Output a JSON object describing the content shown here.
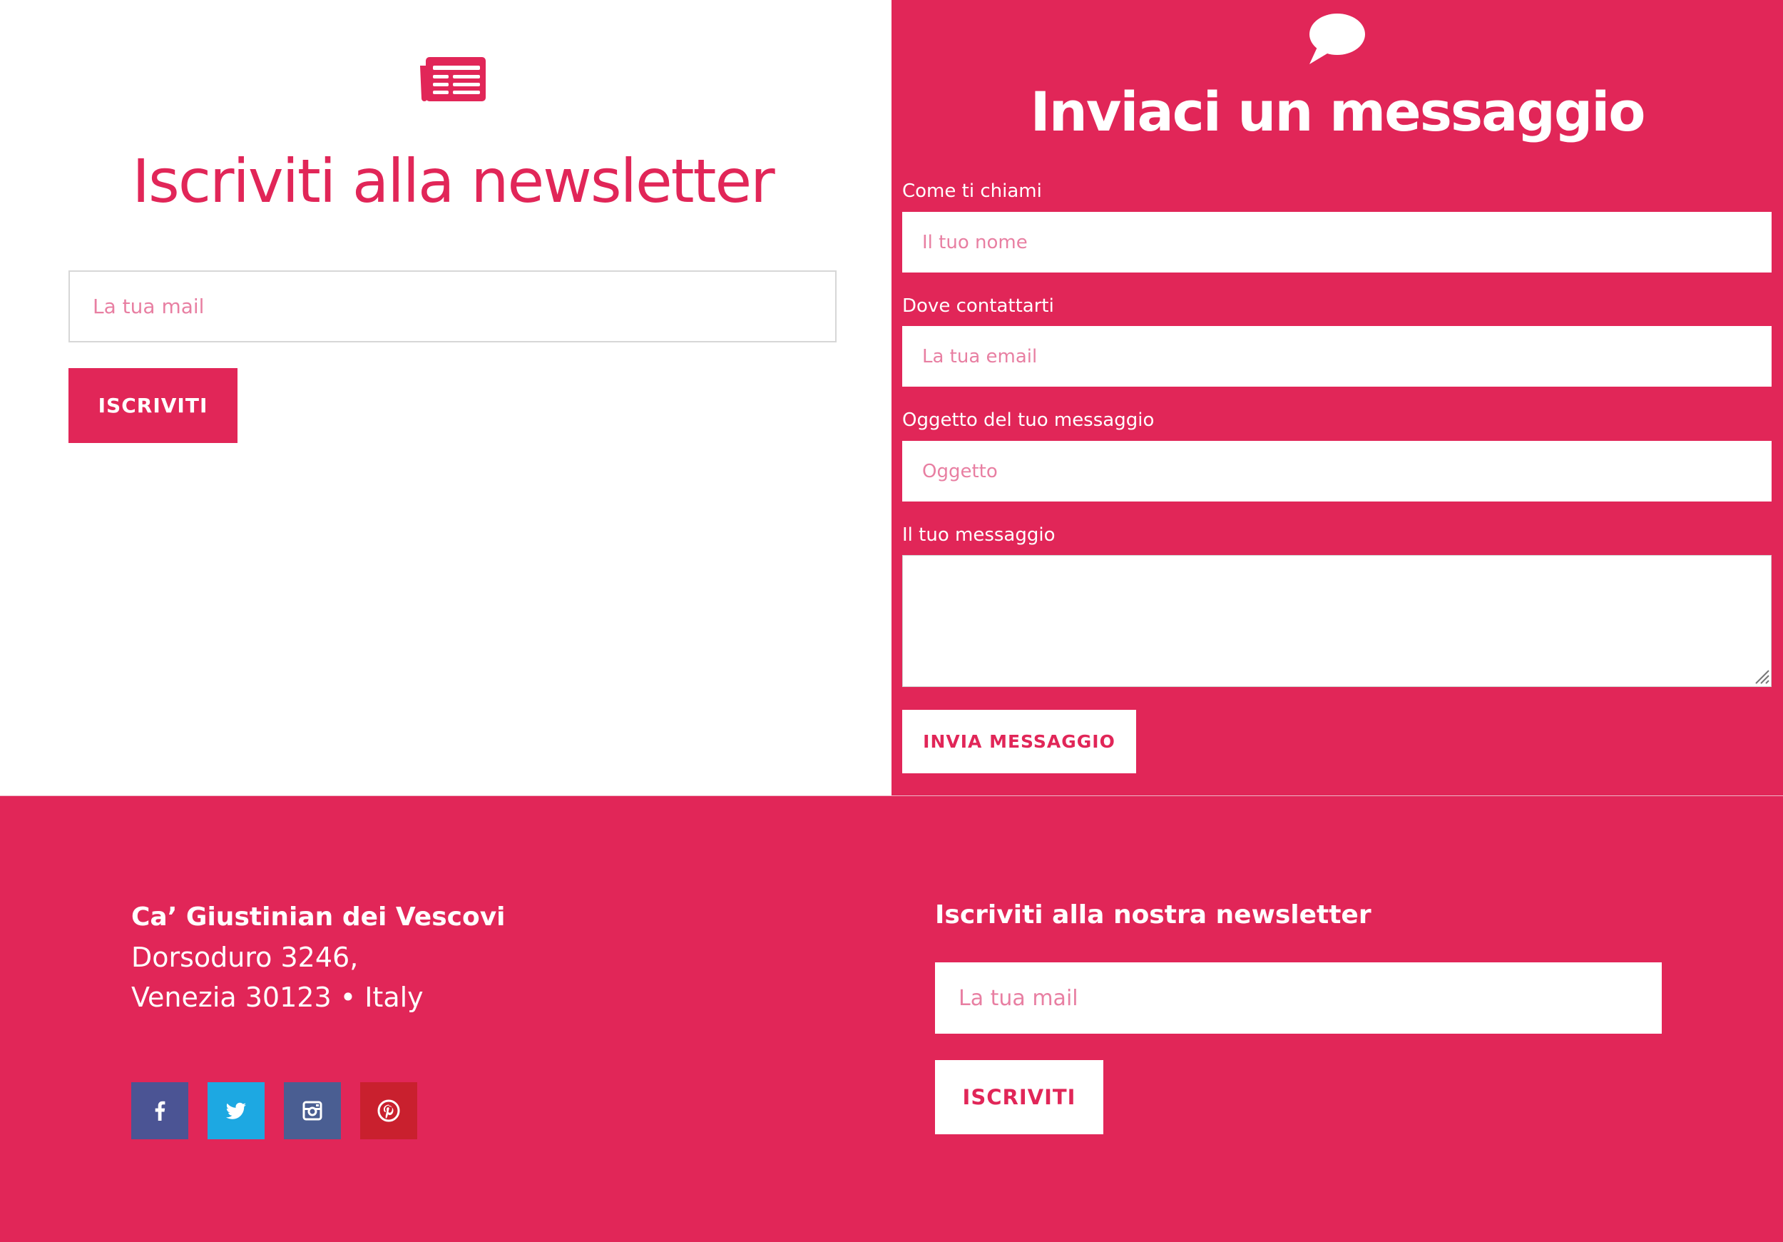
{
  "colors": {
    "brand": "#e12658",
    "white": "#ffffff",
    "placeholder": "#e87fa2"
  },
  "newsletter": {
    "icon": "newspaper-icon",
    "title": "Iscriviti alla newsletter",
    "email_placeholder": "La tua mail",
    "button_label": "ISCRIVITI"
  },
  "contact": {
    "icon": "speech-bubble-icon",
    "title": "Inviaci un messaggio",
    "fields": [
      {
        "label": "Come ti chiami",
        "placeholder": "Il tuo nome"
      },
      {
        "label": "Dove contattarti",
        "placeholder": "La tua email"
      },
      {
        "label": "Oggetto del tuo messaggio",
        "placeholder": "Oggetto"
      },
      {
        "label": "Il tuo messaggio",
        "placeholder": ""
      }
    ],
    "button_label": "INVIA MESSAGGIO"
  },
  "footer": {
    "address": {
      "name": "Ca’ Giustinian dei Vescovi",
      "line1": "Dorsoduro 3246,",
      "line2": "Venezia 30123 • Italy"
    },
    "social": [
      {
        "icon": "facebook-icon",
        "color": "#4b5494"
      },
      {
        "icon": "twitter-icon",
        "color": "#1da8e2"
      },
      {
        "icon": "instagram-icon",
        "color": "#4a5e92"
      },
      {
        "icon": "pinterest-icon",
        "color": "#c9202e"
      }
    ],
    "newsletter": {
      "title": "Iscriviti alla nostra newsletter",
      "email_placeholder": "La tua mail",
      "button_label": "ISCRIVITI"
    }
  }
}
